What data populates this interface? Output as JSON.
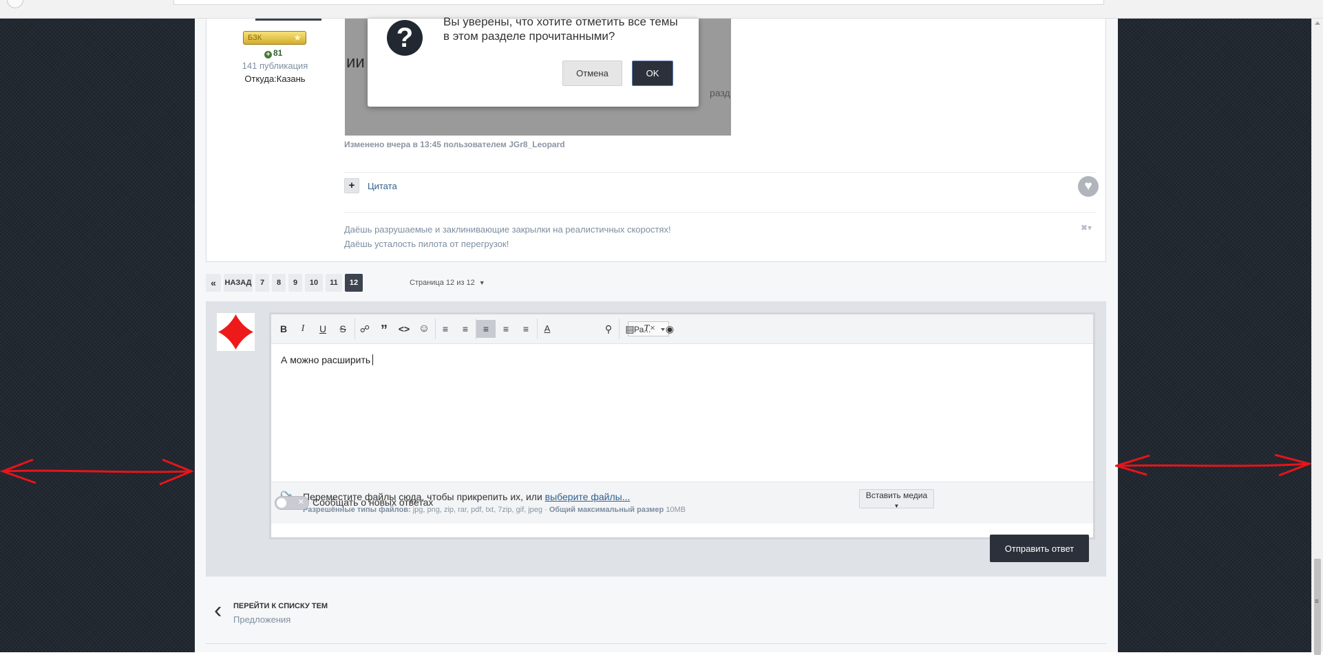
{
  "post": {
    "badge": "БЗК",
    "reputation": "81",
    "publications": "141 публикация",
    "location": "Откуда:Казань",
    "embed_text": "ии и",
    "embed_text2": "разд",
    "edited": "Изменено вчера в 13:45 пользователем JGr8_Leopard",
    "quote_plus": "+",
    "quote_label": "Цитата",
    "signature": [
      "Даёшь разрушаемые и заклинивающие закрылки на реалистичных скоростях!",
      "Даёшь усталость пилота от перегрузок!"
    ]
  },
  "dialog": {
    "icon": "?",
    "message": "Вы уверены, что хотите отметить все темы в этом разделе прочитанными?",
    "cancel": "Отмена",
    "ok": "OK"
  },
  "pagination": {
    "first": "«",
    "back": "НАЗАД",
    "pages": [
      "7",
      "8",
      "9",
      "10",
      "11",
      "12"
    ],
    "active": "12",
    "info": "Страница 12 из 12"
  },
  "editor": {
    "text": "А можно расширить",
    "font_select": "Ра...",
    "toolbar": {
      "bold": "B",
      "italic": "I",
      "underline": "U",
      "strike": "S"
    },
    "attach_text": "Переместите файлы сюда, чтобы прикрепить их, или",
    "attach_link": "выберите файлы...",
    "allowed_label": "Разрешённые типы файлов:",
    "allowed_types": "jpg, png, zip, rar, pdf, txt, 7zip, gif, jpeg",
    "max_size_label": "Общий максимальный размер",
    "max_size": "10MB",
    "media_button": "Вставить медиа",
    "notify_label": "Сообщать о новых ответах",
    "submit": "Отправить ответ"
  },
  "back_nav": {
    "title": "ПЕРЕЙТИ К СПИСКУ ТЕМ",
    "subtitle": "Предложения"
  },
  "colors": {
    "side_bg": "#222831",
    "dark_button": "#2b303a",
    "link": "#2f5f8f",
    "annotation": "#e8141a",
    "avatar_diamond": "#ee1a1a"
  }
}
